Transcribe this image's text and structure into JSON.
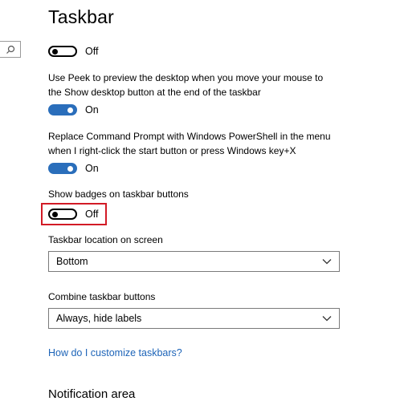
{
  "page": {
    "title": "Taskbar",
    "subheading": "Notification area",
    "help_link": "How do I customize taskbars?"
  },
  "search": {
    "icon": "search-icon"
  },
  "settings": [
    {
      "id": "first_toggle",
      "description": "",
      "state": "Off"
    },
    {
      "id": "peek",
      "description_line1": "Use Peek to preview the desktop when you move your mouse to",
      "description_line2": "the Show desktop button at the end of the taskbar",
      "state": "On"
    },
    {
      "id": "powershell",
      "description_line1": "Replace Command Prompt with Windows PowerShell in the menu",
      "description_line2": "when I right-click the start button or press Windows key+X",
      "state": "On"
    },
    {
      "id": "badges",
      "description_line1": "Show badges on taskbar buttons",
      "state": "Off"
    }
  ],
  "taskbar_location": {
    "label": "Taskbar location on screen",
    "value": "Bottom"
  },
  "combine_buttons": {
    "label": "Combine taskbar buttons",
    "value": "Always, hide labels"
  },
  "colors": {
    "toggle_on": "#2a6ebb",
    "highlight": "#d21b26",
    "link": "#1d64b8"
  }
}
